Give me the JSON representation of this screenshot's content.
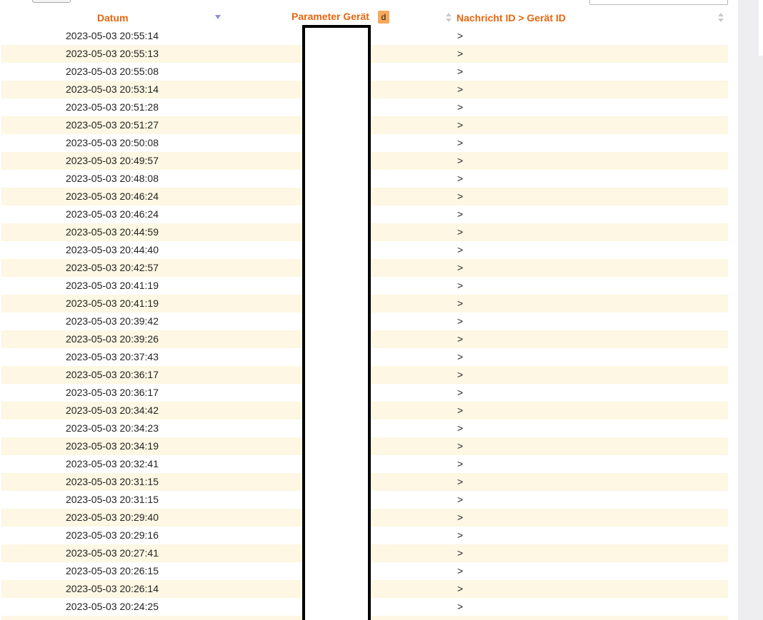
{
  "table": {
    "columns": {
      "datum": "Datum",
      "parameter": "Parameter Gerät",
      "parameter_badge": "d",
      "nachricht": "Nachricht ID > Gerät ID"
    },
    "rows": [
      {
        "datum": "2023-05-03 20:55:14",
        "nachricht": ">"
      },
      {
        "datum": "2023-05-03 20:55:13",
        "nachricht": ">"
      },
      {
        "datum": "2023-05-03 20:55:08",
        "nachricht": ">"
      },
      {
        "datum": "2023-05-03 20:53:14",
        "nachricht": ">"
      },
      {
        "datum": "2023-05-03 20:51:28",
        "nachricht": ">"
      },
      {
        "datum": "2023-05-03 20:51:27",
        "nachricht": ">"
      },
      {
        "datum": "2023-05-03 20:50:08",
        "nachricht": ">"
      },
      {
        "datum": "2023-05-03 20:49:57",
        "nachricht": ">"
      },
      {
        "datum": "2023-05-03 20:48:08",
        "nachricht": ">"
      },
      {
        "datum": "2023-05-03 20:46:24",
        "nachricht": ">"
      },
      {
        "datum": "2023-05-03 20:46:24",
        "nachricht": ">"
      },
      {
        "datum": "2023-05-03 20:44:59",
        "nachricht": ">"
      },
      {
        "datum": "2023-05-03 20:44:40",
        "nachricht": ">"
      },
      {
        "datum": "2023-05-03 20:42:57",
        "nachricht": ">"
      },
      {
        "datum": "2023-05-03 20:41:19",
        "nachricht": ">"
      },
      {
        "datum": "2023-05-03 20:41:19",
        "nachricht": ">"
      },
      {
        "datum": "2023-05-03 20:39:42",
        "nachricht": ">"
      },
      {
        "datum": "2023-05-03 20:39:26",
        "nachricht": ">"
      },
      {
        "datum": "2023-05-03 20:37:43",
        "nachricht": ">"
      },
      {
        "datum": "2023-05-03 20:36:17",
        "nachricht": ">"
      },
      {
        "datum": "2023-05-03 20:36:17",
        "nachricht": ">"
      },
      {
        "datum": "2023-05-03 20:34:42",
        "nachricht": ">"
      },
      {
        "datum": "2023-05-03 20:34:23",
        "nachricht": ">"
      },
      {
        "datum": "2023-05-03 20:34:19",
        "nachricht": ">"
      },
      {
        "datum": "2023-05-03 20:32:41",
        "nachricht": ">"
      },
      {
        "datum": "2023-05-03 20:31:15",
        "nachricht": ">"
      },
      {
        "datum": "2023-05-03 20:31:15",
        "nachricht": ">"
      },
      {
        "datum": "2023-05-03 20:29:40",
        "nachricht": ">"
      },
      {
        "datum": "2023-05-03 20:29:16",
        "nachricht": ">"
      },
      {
        "datum": "2023-05-03 20:27:41",
        "nachricht": ">"
      },
      {
        "datum": "2023-05-03 20:26:15",
        "nachricht": ">"
      },
      {
        "datum": "2023-05-03 20:26:14",
        "nachricht": ">"
      },
      {
        "datum": "2023-05-03 20:24:25",
        "nachricht": ">"
      },
      {
        "datum": "",
        "nachricht": ""
      }
    ]
  },
  "icons": {
    "sort_active": "sort-descending-icon",
    "sort_inactive": "sort-both-icon"
  },
  "colors": {
    "header_text": "#e8650d",
    "row_stripe": "#fdf7e3",
    "badge": "#f7a95a",
    "sort_active": "#8a93c9",
    "gutter": "#eeeef1"
  }
}
